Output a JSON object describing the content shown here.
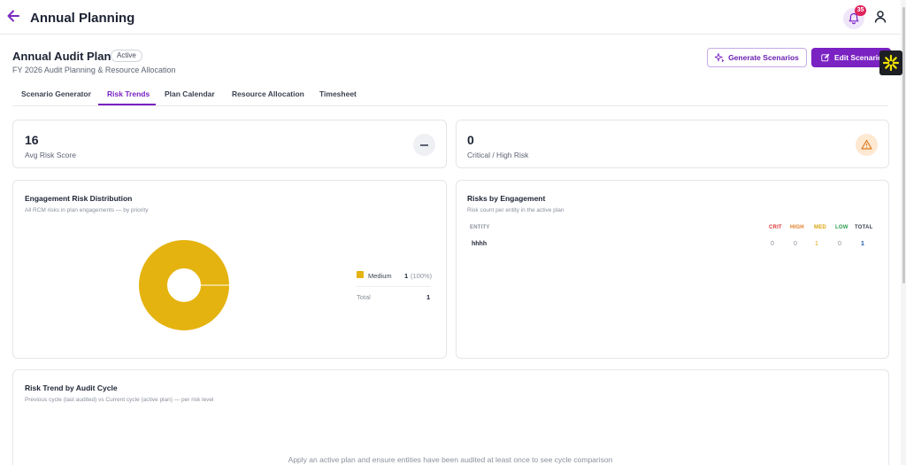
{
  "header": {
    "app_title": "Annual Planning",
    "notification_count": "35"
  },
  "plan": {
    "title": "Annual Audit Plan",
    "status": "Active",
    "subtitle": "FY 2026 Audit Planning & Resource Allocation"
  },
  "actions": {
    "generate_label": "Generate Scenarios",
    "edit_label": "Edit Scenario"
  },
  "tabs": [
    {
      "label": "Scenario Generator",
      "active": false
    },
    {
      "label": "Risk Trends",
      "active": true
    },
    {
      "label": "Plan Calendar",
      "active": false
    },
    {
      "label": "Resource Allocation",
      "active": false
    },
    {
      "label": "Timesheet",
      "active": false
    }
  ],
  "stats": {
    "avg_risk": {
      "value": "16",
      "label": "Avg Risk Score"
    },
    "critical_high": {
      "value": "0",
      "label": "Critical / High Risk"
    }
  },
  "distribution": {
    "title": "Engagement Risk Distribution",
    "subtitle": "All RCM risks in plan engagements — by priority",
    "legend": [
      {
        "label": "Medium",
        "count": "1",
        "percent": "(100%)",
        "color": "#E5B30F"
      }
    ],
    "total_label": "Total",
    "total_value": "1"
  },
  "chart_data": {
    "type": "pie",
    "variant": "donut",
    "categories": [
      "Medium"
    ],
    "values": [
      1
    ],
    "colors": [
      "#E5B30F"
    ]
  },
  "engagement": {
    "title": "Risks by Engagement",
    "subtitle": "Risk count per entity in the active plan",
    "columns": [
      {
        "label": "ENTITY",
        "color": "#8a909c"
      },
      {
        "label": "CRIT",
        "color": "#d93636"
      },
      {
        "label": "HIGH",
        "color": "#e07a1f"
      },
      {
        "label": "MED",
        "color": "#d9a50c"
      },
      {
        "label": "LOW",
        "color": "#2e9d4f"
      },
      {
        "label": "TOTAL",
        "color": "#3b4252"
      }
    ],
    "rows": [
      {
        "entity": "hhhh",
        "crit": "0",
        "high": "0",
        "med": "1",
        "low": "0",
        "total": "1"
      }
    ]
  },
  "trend": {
    "title": "Risk Trend by Audit Cycle",
    "subtitle": "Previous cycle (last audited) vs Current cycle (active plan) — per risk level",
    "empty_message": "Apply an active plan and ensure entities have been audited at least once to see cycle comparison"
  }
}
